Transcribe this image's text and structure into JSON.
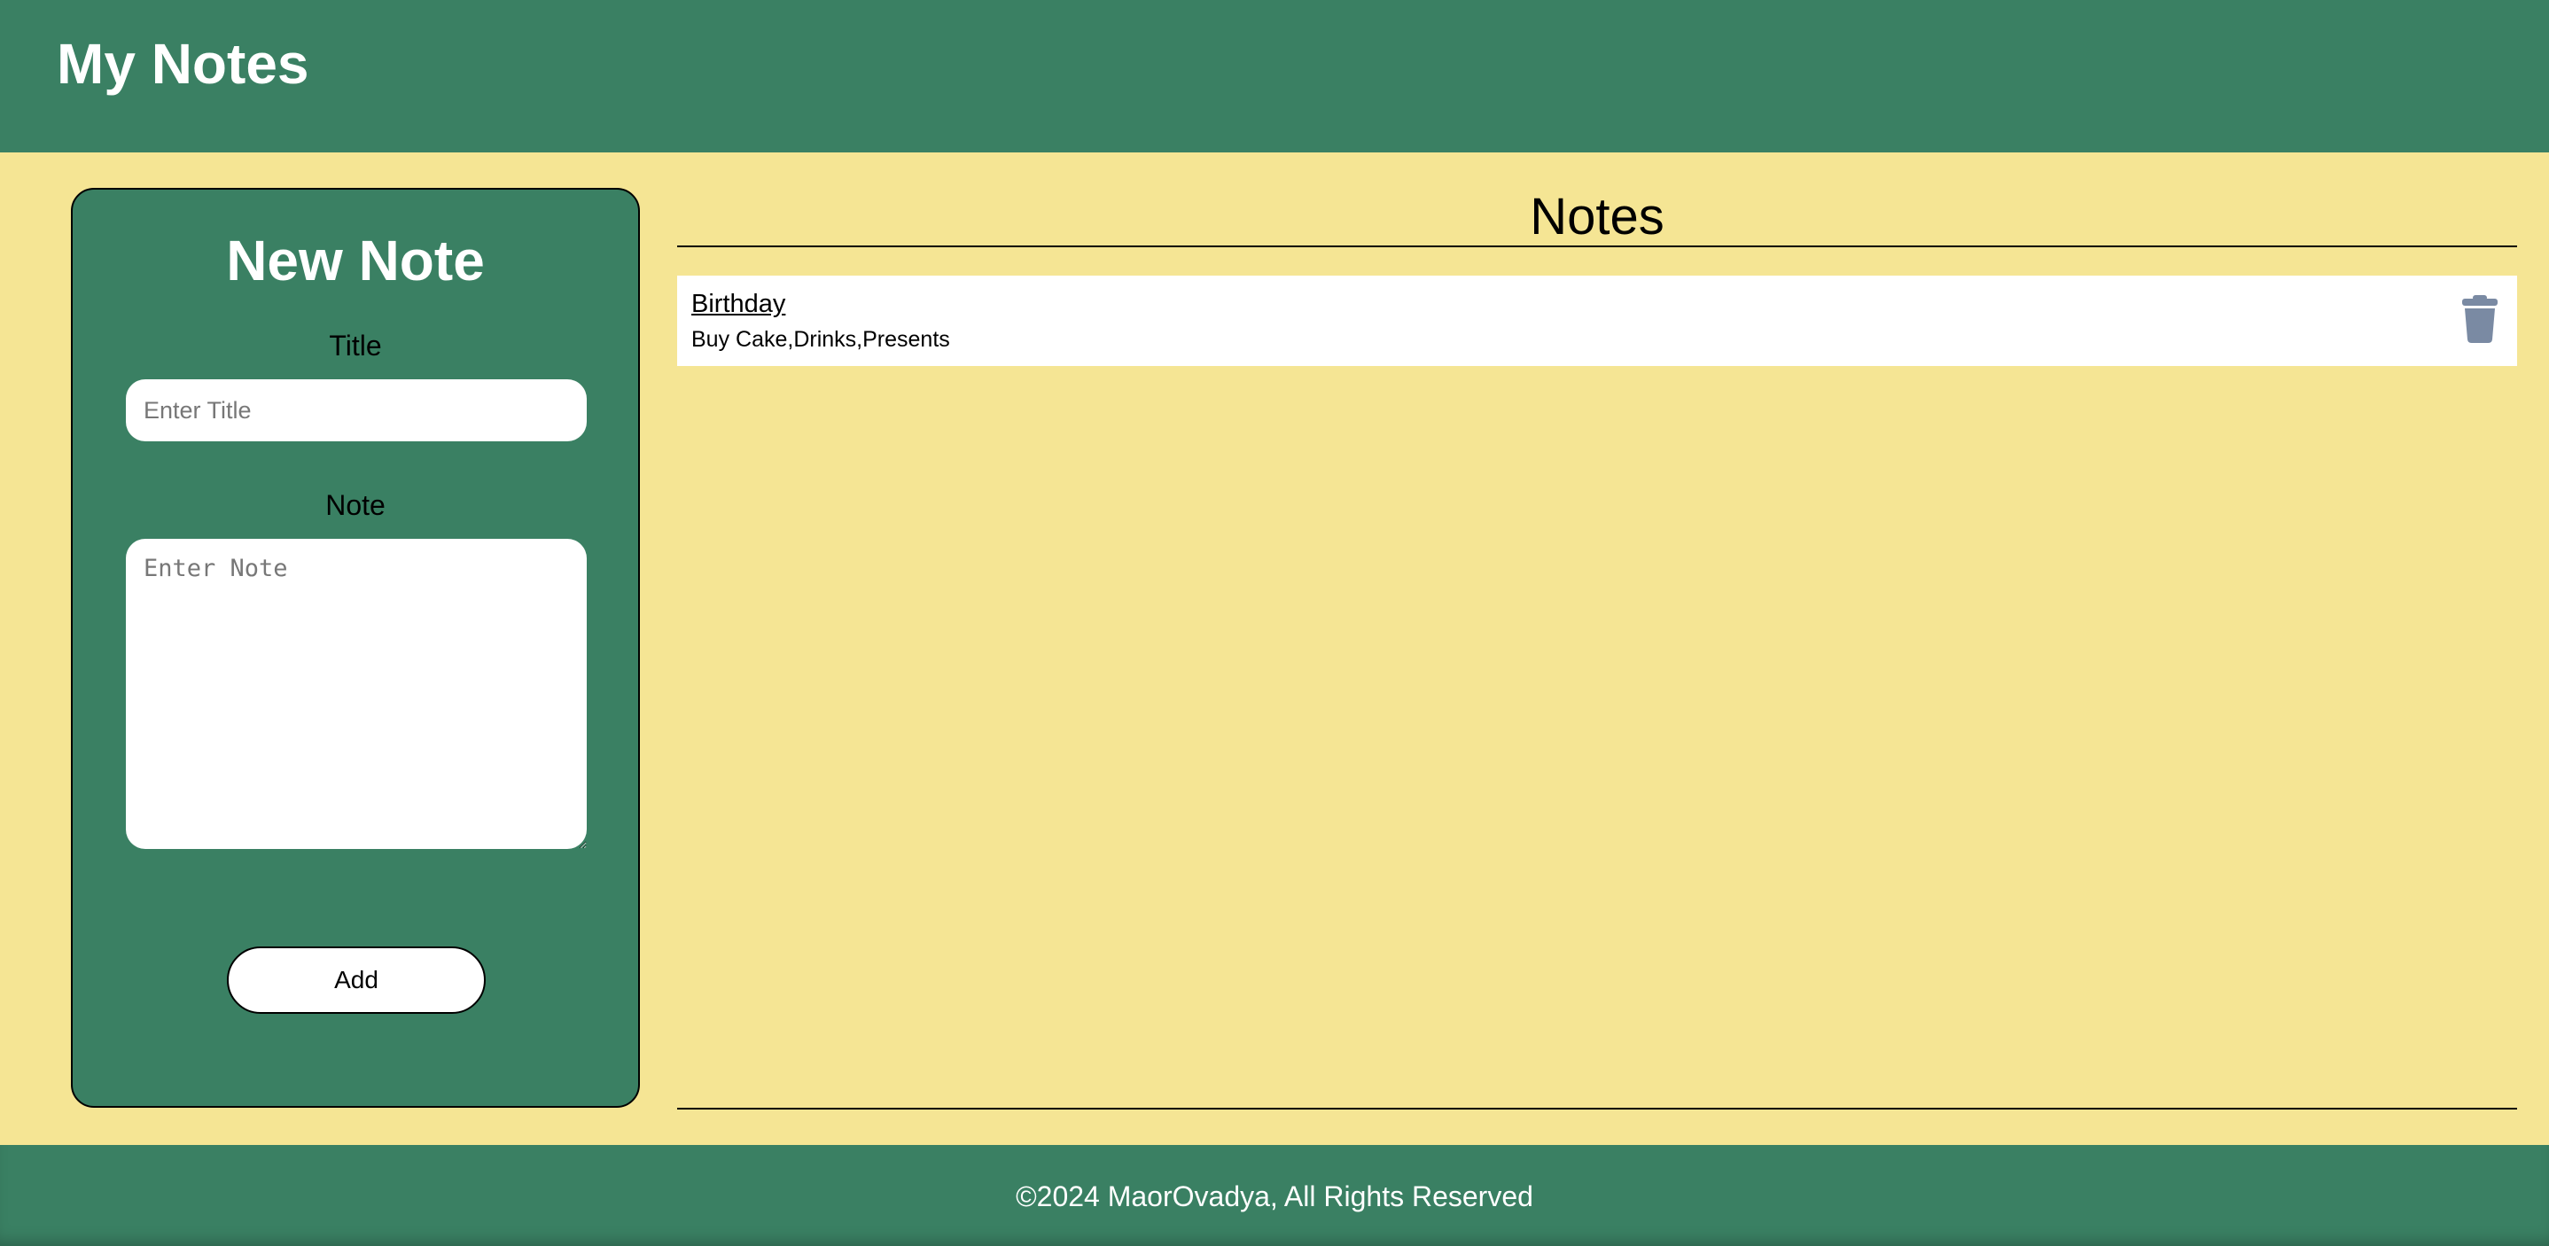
{
  "header": {
    "title": "My Notes"
  },
  "form": {
    "title": "New Note",
    "title_label": "Title",
    "title_placeholder": "Enter Title",
    "title_value": "",
    "note_label": "Note",
    "note_placeholder": "Enter Note",
    "note_value": "",
    "add_label": "Add"
  },
  "notes_section": {
    "heading": "Notes",
    "items": [
      {
        "title": "Birthday",
        "body": "Buy Cake,Drinks,Presents",
        "action_icon": "trash-icon"
      }
    ]
  },
  "footer": {
    "text": "©2024 MaorOvadya, All Rights Reserved"
  },
  "colors": {
    "primary": "#3a8063",
    "background": "#f5e594",
    "card": "#ffffff",
    "icon": "#7a8aa3"
  }
}
